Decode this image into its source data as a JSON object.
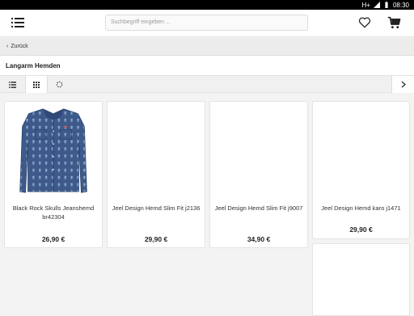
{
  "status_bar": {
    "network": "H+",
    "time": "08:30"
  },
  "header": {
    "menu_icon": "hamburger-menu-icon",
    "search_placeholder": "Suchbegriff eingeben ...",
    "wishlist_icon": "heart-icon",
    "cart_icon": "shopping-cart-icon"
  },
  "nav": {
    "back_label": "Zurück"
  },
  "page": {
    "title": "Langarm Hemden"
  },
  "toolbar": {
    "buttons": [
      {
        "icon": "list-view-icon",
        "active": false
      },
      {
        "icon": "grid-view-icon",
        "active": true
      },
      {
        "icon": "loading-spinner-icon",
        "active": false
      }
    ],
    "next_icon": "chevron-right-icon"
  },
  "products": [
    {
      "name": "Black Rock Skulls Jeanshemd br42304",
      "price": "26,90 €",
      "has_image": true
    },
    {
      "name": "Jeel Design Hemd Slim Fit j2136",
      "price": "29,90 €",
      "has_image": false
    },
    {
      "name": "Jeel Design Hemd Slim Fit j9007",
      "price": "34,90 €",
      "has_image": false
    },
    {
      "name": "Jeel Design Hemd karo j1471",
      "price": "29,90 €",
      "has_image": false
    }
  ],
  "colors": {
    "accent": "#222222",
    "shirt_denim": "#3d5a8a"
  }
}
